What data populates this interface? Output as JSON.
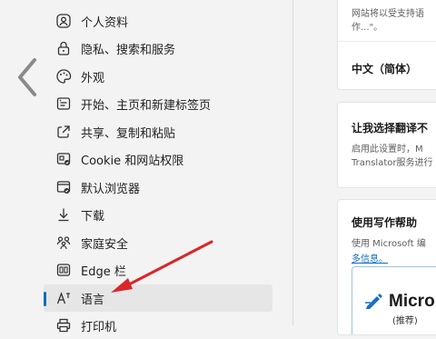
{
  "sidebar": {
    "items": [
      {
        "label": "个人资料",
        "icon": "profile-icon"
      },
      {
        "label": "隐私、搜索和服务",
        "icon": "lock-icon"
      },
      {
        "label": "外观",
        "icon": "appearance-icon"
      },
      {
        "label": "开始、主页和新建标签页",
        "icon": "start-page-icon"
      },
      {
        "label": "共享、复制和粘贴",
        "icon": "share-icon"
      },
      {
        "label": "Cookie 和网站权限",
        "icon": "site-permissions-icon"
      },
      {
        "label": "默认浏览器",
        "icon": "default-browser-icon"
      },
      {
        "label": "下载",
        "icon": "download-icon"
      },
      {
        "label": "家庭安全",
        "icon": "family-icon"
      },
      {
        "label": "Edge 栏",
        "icon": "edge-bar-icon"
      },
      {
        "label": "语言",
        "icon": "language-icon",
        "selected": true
      },
      {
        "label": "打印机",
        "icon": "printer-icon"
      }
    ]
  },
  "content": {
    "card1": {
      "line1": "网站将以受支持语",
      "line2": "作...\"。",
      "language": "中文（简体）"
    },
    "card2": {
      "title": "让我选择翻译不",
      "line1": "启用此设置时，M",
      "line2": "Translator服务进行"
    },
    "card3": {
      "title": "使用写作帮助",
      "line1": "使用 Microsoft 编",
      "link": "多信息。",
      "brand": "Micro",
      "recommended": "(推荐)"
    }
  },
  "colors": {
    "accent": "#0f6cbd",
    "annotation_arrow": "#d9262a"
  }
}
